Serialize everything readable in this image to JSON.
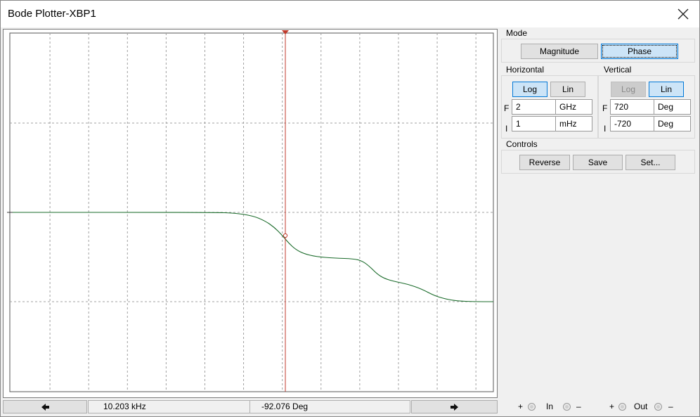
{
  "window": {
    "title": "Bode Plotter-XBP1"
  },
  "mode": {
    "label": "Mode",
    "magnitude_label": "Magnitude",
    "phase_label": "Phase",
    "selected": "Phase"
  },
  "horizontal": {
    "label": "Horizontal",
    "log_label": "Log",
    "lin_label": "Lin",
    "selected": "Log",
    "final_prefix": "F",
    "initial_prefix": "I",
    "final_value": "2",
    "final_unit": "GHz",
    "initial_value": "1",
    "initial_unit": "mHz"
  },
  "vertical": {
    "label": "Vertical",
    "log_label": "Log",
    "lin_label": "Lin",
    "selected": "Lin",
    "final_prefix": "F",
    "initial_prefix": "I",
    "final_value": "720",
    "final_unit": "Deg",
    "initial_value": "-720",
    "initial_unit": "Deg"
  },
  "controls": {
    "label": "Controls",
    "reverse_label": "Reverse",
    "save_label": "Save",
    "set_label": "Set..."
  },
  "status": {
    "frequency_readout": "10.203 kHz",
    "value_readout": "-92.076 Deg"
  },
  "terminals": {
    "in_label": "In",
    "out_label": "Out",
    "plus": "+",
    "minus": "–"
  },
  "plot": {
    "trace_color": "#1a6b2a",
    "cursor_color": "#c0392b",
    "grid_color": "#a0a0a0",
    "y_axis": "Phase (Deg)",
    "y_range": [
      -720,
      720
    ],
    "x_range_hz": [
      0.001,
      2000000000
    ],
    "cursor": {
      "frequency": "10.203 kHz",
      "phase_deg": -92.076
    }
  }
}
